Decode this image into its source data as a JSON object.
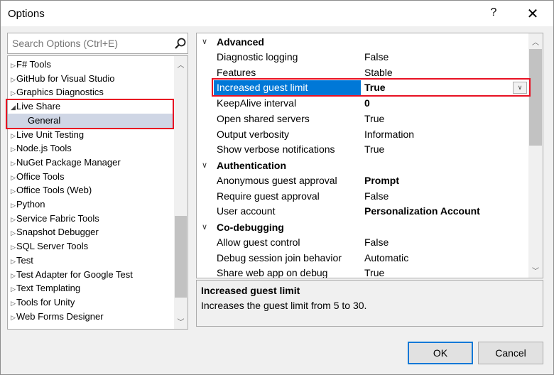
{
  "window": {
    "title": "Options",
    "help_label": "?",
    "close_label": "✕"
  },
  "search": {
    "placeholder": "Search Options (Ctrl+E)"
  },
  "tree": {
    "items": [
      {
        "label": "F# Tools",
        "arrow": "▷"
      },
      {
        "label": "GitHub for Visual Studio",
        "arrow": "▷"
      },
      {
        "label": "Graphics Diagnostics",
        "arrow": "▷"
      },
      {
        "label": "Live Share",
        "arrow": "◢"
      },
      {
        "label": "General",
        "arrow": ""
      },
      {
        "label": "Live Unit Testing",
        "arrow": "▷"
      },
      {
        "label": "Node.js Tools",
        "arrow": "▷"
      },
      {
        "label": "NuGet Package Manager",
        "arrow": "▷"
      },
      {
        "label": "Office Tools",
        "arrow": "▷"
      },
      {
        "label": "Office Tools (Web)",
        "arrow": "▷"
      },
      {
        "label": "Python",
        "arrow": "▷"
      },
      {
        "label": "Service Fabric Tools",
        "arrow": "▷"
      },
      {
        "label": "Snapshot Debugger",
        "arrow": "▷"
      },
      {
        "label": "SQL Server Tools",
        "arrow": "▷"
      },
      {
        "label": "Test",
        "arrow": "▷"
      },
      {
        "label": "Test Adapter for Google Test",
        "arrow": "▷"
      },
      {
        "label": "Text Templating",
        "arrow": "▷"
      },
      {
        "label": "Tools for Unity",
        "arrow": "▷"
      },
      {
        "label": "Web Forms Designer",
        "arrow": "▷"
      }
    ],
    "selected_index": 4
  },
  "grid": {
    "categories": [
      {
        "label": "Advanced",
        "rows": [
          {
            "name": "Diagnostic logging",
            "value": "False",
            "bold": false
          },
          {
            "name": "Features",
            "value": "Stable",
            "bold": false
          },
          {
            "name": "Increased guest limit",
            "value": "True",
            "bold": true
          },
          {
            "name": "KeepAlive interval",
            "value": "0",
            "bold": true
          },
          {
            "name": "Open shared servers",
            "value": "True",
            "bold": false
          },
          {
            "name": "Output verbosity",
            "value": "Information",
            "bold": false
          },
          {
            "name": "Show verbose notifications",
            "value": "True",
            "bold": false
          }
        ]
      },
      {
        "label": "Authentication",
        "rows": [
          {
            "name": "Anonymous guest approval",
            "value": "Prompt",
            "bold": true
          },
          {
            "name": "Require guest approval",
            "value": "False",
            "bold": false
          },
          {
            "name": "User account",
            "value": "Personalization Account",
            "bold": true
          }
        ]
      },
      {
        "label": "Co-debugging",
        "rows": [
          {
            "name": "Allow guest control",
            "value": "False",
            "bold": false
          },
          {
            "name": "Debug session join behavior",
            "value": "Automatic",
            "bold": false
          },
          {
            "name": "Share web app on debug",
            "value": "True",
            "bold": false
          }
        ]
      }
    ]
  },
  "description": {
    "title": "Increased guest limit",
    "text": "Increases the guest limit from 5 to 30."
  },
  "buttons": {
    "ok": "OK",
    "cancel": "Cancel"
  },
  "colors": {
    "selection": "#0078d7",
    "highlight": "#e81123",
    "tree_selected": "#cfd6e5"
  }
}
